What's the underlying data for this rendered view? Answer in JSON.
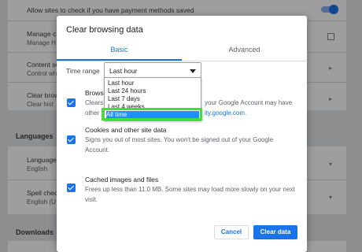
{
  "background": {
    "payment_label": "Allow sites to check if you have payment methods saved",
    "manage1_a": "Manage c",
    "manage1_b": "Manage H",
    "content_a": "Content se",
    "content_b": "Control wh",
    "clear_a": "Clear brow",
    "clear_b": "Clear hist",
    "languages_heading": "Languages",
    "language_a": "Language",
    "language_b": "English",
    "spell_a": "Spell check",
    "spell_b": "English (U",
    "downloads_heading": "Downloads"
  },
  "dialog": {
    "title": "Clear browsing data",
    "tabs": {
      "basic": "Basic",
      "advanced": "Advanced"
    },
    "time_range": {
      "label": "Time range",
      "value": "Last hour",
      "options": [
        "Last hour",
        "Last 24 hours",
        "Last 7 days",
        "Last 4 weeks",
        "All time"
      ],
      "selected": "All time"
    },
    "items": [
      {
        "title": "Browsi",
        "desc_line1_a": "Clears",
        "desc_line1_b": "your Google Account may have",
        "desc_line2_a": "other f",
        "desc_line2_link": "ity.google.com",
        "desc_line2_end": "."
      },
      {
        "title": "Cookies and other site data",
        "desc": "Signs you out of most sites. You won't be signed out of your Google Account."
      },
      {
        "title": "Cached images and files",
        "desc": "Frees up less than 11.0 MB. Some sites may load more slowly on your next visit."
      }
    ],
    "buttons": {
      "cancel": "Cancel",
      "clear": "Clear data"
    }
  },
  "colors": {
    "accent": "#1a73e8",
    "selected_option": "#1e90ff",
    "highlight_box": "#3de03d"
  }
}
